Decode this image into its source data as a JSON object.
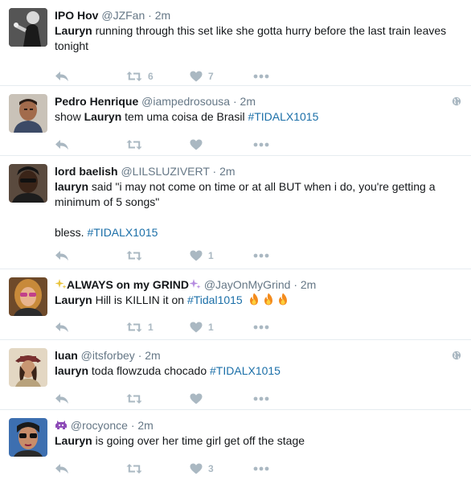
{
  "tweets": [
    {
      "fullname": "IPO Hov",
      "username": "@JZFan",
      "time": "2m",
      "text": [
        [
          "hl",
          "Lauryn"
        ],
        [
          "t",
          " running through this set like she gotta hurry before the last train leaves tonight"
        ]
      ],
      "retweets": "6",
      "likes": "7",
      "geo": false
    },
    {
      "fullname": "Pedro Henrique",
      "username": "@iampedrosousa",
      "time": "2m",
      "text": [
        [
          "t",
          "show "
        ],
        [
          "hl",
          "Lauryn"
        ],
        [
          "t",
          " tem uma coisa de Brasil "
        ],
        [
          "tag",
          "#TIDALX1015"
        ]
      ],
      "retweets": "",
      "likes": "",
      "geo": true
    },
    {
      "fullname": "lord baelish",
      "username": "@LILSLUZIVERT",
      "time": "2m",
      "text": [
        [
          "hl",
          "lauryn"
        ],
        [
          "t",
          " said \"i may not come on time or at all BUT when i do, you're getting a minimum of 5 songs\""
        ]
      ],
      "text2": [
        [
          "t",
          "bless. "
        ],
        [
          "tag",
          "#TIDALX1015"
        ]
      ],
      "retweets": "",
      "likes": "1",
      "geo": false
    },
    {
      "fullname": "ALWAYS on my GRIND",
      "username": "@JayOnMyGrind",
      "time": "2m",
      "text": [
        [
          "hl",
          "Lauryn"
        ],
        [
          "t",
          " Hill is KILLIN it on "
        ],
        [
          "tag",
          "#Tidal1015"
        ]
      ],
      "retweets": "1",
      "likes": "1",
      "geo": false
    },
    {
      "fullname": "luan",
      "username": "@itsforbey",
      "time": "2m",
      "text": [
        [
          "hl",
          "lauryn"
        ],
        [
          "t",
          " toda flowzuda chocado "
        ],
        [
          "tag",
          "#TIDALX1015"
        ]
      ],
      "retweets": "",
      "likes": "",
      "geo": true
    },
    {
      "fullname": "",
      "username": "@rocyonce",
      "time": "2m",
      "text": [
        [
          "hl",
          "Lauryn"
        ],
        [
          "t",
          " is going over her time girl get off the stage"
        ]
      ],
      "retweets": "",
      "likes": "3",
      "geo": false
    }
  ],
  "separator": "·",
  "icons": {
    "reply": "reply-icon",
    "retweet": "retweet-icon",
    "like": "heart-icon",
    "more": "more-icon",
    "geo": "globe-icon"
  },
  "colors": {
    "action_gray": "#aab8c2",
    "hashtag": "#1b6fa8",
    "secondary": "#657786"
  }
}
